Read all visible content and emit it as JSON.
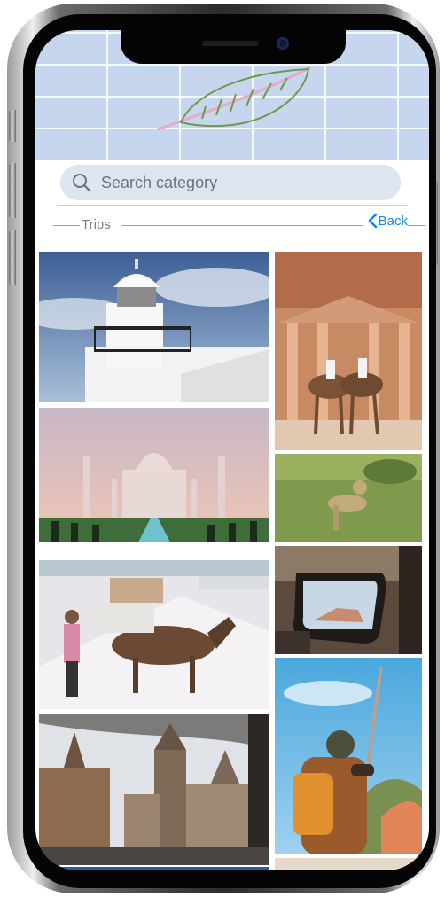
{
  "search": {
    "placeholder": "Search category"
  },
  "section": {
    "title": "Trips"
  },
  "nav": {
    "back_label": "Back"
  },
  "colors": {
    "accent": "#1a86e8",
    "header_bg": "#c7d6ef",
    "search_bg": "#dfe5f0"
  },
  "gallery": {
    "left": [
      {
        "subject": "lighthouse"
      },
      {
        "subject": "taj-mahal"
      },
      {
        "subject": "pack-horse"
      },
      {
        "subject": "gothic-city"
      }
    ],
    "right": [
      {
        "subject": "petra-camels"
      },
      {
        "subject": "cheetah-grass"
      },
      {
        "subject": "car-mirror"
      },
      {
        "subject": "hiker-backpack"
      }
    ]
  }
}
